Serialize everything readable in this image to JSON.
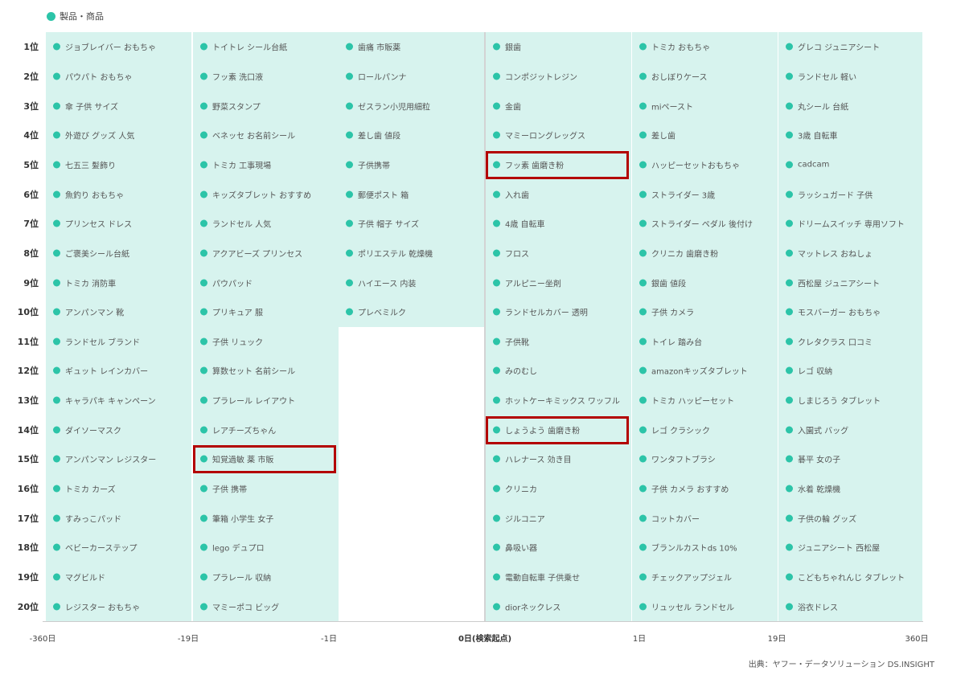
{
  "legend": {
    "label": "製品・商品",
    "color": "#2cc4a8"
  },
  "colors": {
    "column_bg": "#d7f3ee",
    "dot": "#2cc4a8",
    "highlight": "#b30000"
  },
  "source": "出典：ヤフー・データソリューション DS.INSIGHT",
  "chart_data": {
    "type": "table",
    "series_name": "製品・商品",
    "ranks": [
      "1位",
      "2位",
      "3位",
      "4位",
      "5位",
      "6位",
      "7位",
      "8位",
      "9位",
      "10位",
      "11位",
      "12位",
      "13位",
      "14位",
      "15位",
      "16位",
      "17位",
      "18位",
      "19位",
      "20位"
    ],
    "x_ticks": [
      "-360日",
      "-19日",
      "-1日",
      "0日(検索起点)",
      "1日",
      "19日",
      "360日"
    ],
    "columns": [
      {
        "range": [
          "-360日",
          "-19日"
        ],
        "items": [
          "ジョブレイバー おもちゃ",
          "パウパト おもちゃ",
          "傘 子供 サイズ",
          "外遊び グッズ 人気",
          "七五三 髪飾り",
          "魚釣り おもちゃ",
          "プリンセス ドレス",
          "ご褒美シール台紙",
          "トミカ 消防車",
          "アンパンマン 靴",
          "ランドセル ブランド",
          "ギュット レインカバー",
          "キャラパキ キャンペーン",
          "ダイソーマスク",
          "アンパンマン レジスター",
          "トミカ カーズ",
          "すみっこパッド",
          "ベビーカーステップ",
          "マグビルド",
          "レジスター おもちゃ"
        ]
      },
      {
        "range": [
          "-19日",
          "-1日"
        ],
        "items": [
          "トイトレ シール台紙",
          "フッ素 洗口液",
          "野菜スタンプ",
          "ベネッセ お名前シール",
          "トミカ 工事現場",
          "キッズタブレット おすすめ",
          "ランドセル 人気",
          "アクアビーズ プリンセス",
          "パウパッド",
          "プリキュア 服",
          "子供 リュック",
          "算数セット 名前シール",
          "プラレール レイアウト",
          "レアチーズちゃん",
          "知覚過敏 薬 市販",
          "子供 携帯",
          "筆箱 小学生 女子",
          "lego デュプロ",
          "プラレール 収納",
          "マミーポコ ビッグ"
        ]
      },
      {
        "range": [
          "-1日",
          "0日(検索起点)"
        ],
        "items": [
          "歯痛 市販薬",
          "ロールパンナ",
          "ゼスラン小児用細粒",
          "差し歯 値段",
          "子供携帯",
          "郵便ポスト 箱",
          "子供 帽子 サイズ",
          "ポリエステル 乾燥機",
          "ハイエース 内装",
          "プレベミルク"
        ]
      },
      {
        "range": [
          "0日(検索起点)",
          "1日"
        ],
        "items": [
          "銀歯",
          "コンポジットレジン",
          "金歯",
          "マミーロングレッグス",
          "フッ素 歯磨き粉",
          "入れ歯",
          "4歳 自転車",
          "フロス",
          "アルピニー坐剤",
          "ランドセルカバー 透明",
          "子供靴",
          "みのむし",
          "ホットケーキミックス ワッフル",
          "しょうよう 歯磨き粉",
          "ハレナース 効き目",
          "クリニカ",
          "ジルコニア",
          "鼻吸い器",
          "電動自転車 子供乗せ",
          "diorネックレス"
        ]
      },
      {
        "range": [
          "1日",
          "19日"
        ],
        "items": [
          "トミカ おもちゃ",
          "おしぼりケース",
          "miペースト",
          "差し歯",
          "ハッピーセットおもちゃ",
          "ストライダー 3歳",
          "ストライダー ペダル 後付け",
          "クリニカ 歯磨き粉",
          "銀歯 値段",
          "子供 カメラ",
          "トイレ 踏み台",
          "amazonキッズタブレット",
          "トミカ ハッピーセット",
          "レゴ クラシック",
          "ワンタフトブラシ",
          "子供 カメラ おすすめ",
          "コットカバー",
          "ブランルカストds 10%",
          "チェックアップジェル",
          "リュッセル ランドセル"
        ]
      },
      {
        "range": [
          "19日",
          "360日"
        ],
        "items": [
          "グレコ ジュニアシート",
          "ランドセル 軽い",
          "丸シール 台紙",
          "3歳 自転車",
          "cadcam",
          "ラッシュガード 子供",
          "ドリームスイッチ 専用ソフト",
          "マットレス おねしょ",
          "西松屋 ジュニアシート",
          "モスバーガー おもちゃ",
          "クレタクラス 口コミ",
          "レゴ 収納",
          "しまじろう タブレット",
          "入園式 バッグ",
          "碁平 女の子",
          "水着 乾燥機",
          "子供の輪 グッズ",
          "ジュニアシート 西松屋",
          "こどもちゃれんじ タブレット",
          "浴衣ドレス"
        ]
      }
    ],
    "highlighted": [
      {
        "column": 1,
        "rank": "15位",
        "item": "知覚過敏 薬 市販"
      },
      {
        "column": 3,
        "rank": "5位",
        "item": "フッ素 歯磨き粉"
      },
      {
        "column": 3,
        "rank": "14位",
        "item": "しょうよう 歯磨き粉"
      }
    ]
  }
}
